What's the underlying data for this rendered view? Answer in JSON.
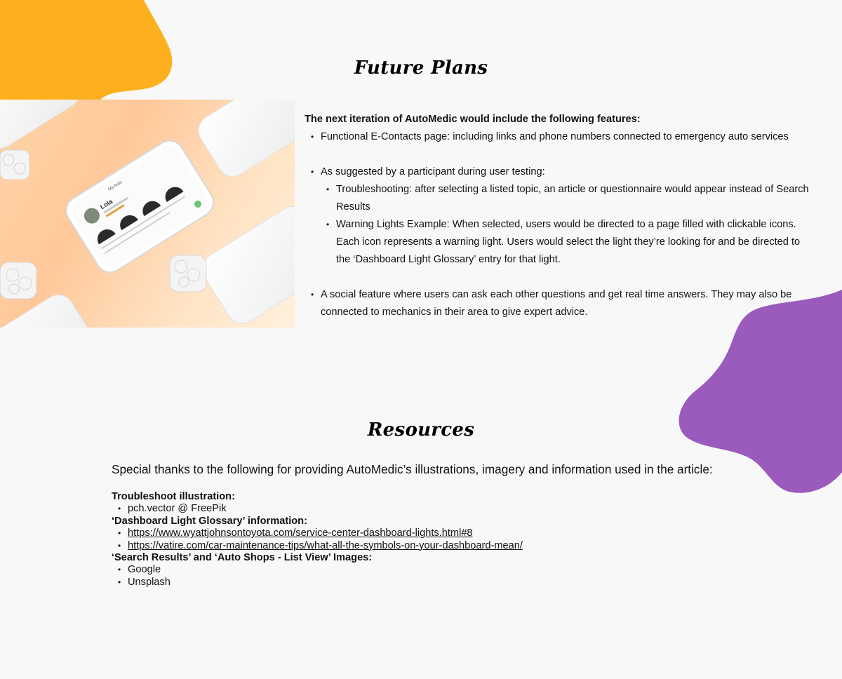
{
  "colors": {
    "background": "#f8f8f8",
    "orange_blob": "#fdb01e",
    "purple_blob": "#9a5bbd",
    "text": "#111111"
  },
  "future_plans": {
    "title": "Future Plans",
    "intro": "The next iteration of AutoMedic would include the following features:",
    "items": [
      {
        "text": "Functional E-Contacts page: including links and phone numbers connected to emergency auto services"
      },
      {
        "text": "As suggested by a participant during user testing:",
        "sub": [
          "Troubleshooting: after selecting a listed topic, an article or questionnaire would appear instead of Search Results",
          "Warning Lights Example: When selected, users would be directed to a page filled with clickable icons. Each icon represents a warning light. Users would select the light they’re looking for and be directed to the ‘Dashboard Light Glossary’ entry for that light."
        ]
      },
      {
        "text": "A social feature where users can ask each other questions and get real time answers. They may also be connected to mechanics in their area to give expert advice."
      }
    ]
  },
  "mockup": {
    "phone_title": "My Auto",
    "user_name": "Lola",
    "icon": "phone-mockup-image"
  },
  "resources": {
    "title": "Resources",
    "intro": "Special thanks to the following for providing AutoMedic’s illustrations, imagery and information used in the article:",
    "sections": [
      {
        "heading": "Troubleshoot illustration:",
        "items": [
          {
            "text": "pch.vector @ FreePik",
            "link": false
          }
        ]
      },
      {
        "heading": "‘Dashboard Light Glossary’ information:",
        "items": [
          {
            "text": "https://www.wyattjohnsontoyota.com/service-center-dashboard-lights.html#8",
            "link": true
          },
          {
            "text": "https://vatire.com/car-maintenance-tips/what-all-the-symbols-on-your-dashboard-mean/",
            "link": true
          }
        ]
      },
      {
        "heading": "‘Search Results’ and ‘Auto Shops - List View’ Images:",
        "items": [
          {
            "text": "Google",
            "link": false
          },
          {
            "text": "Unsplash",
            "link": false
          }
        ]
      }
    ]
  }
}
